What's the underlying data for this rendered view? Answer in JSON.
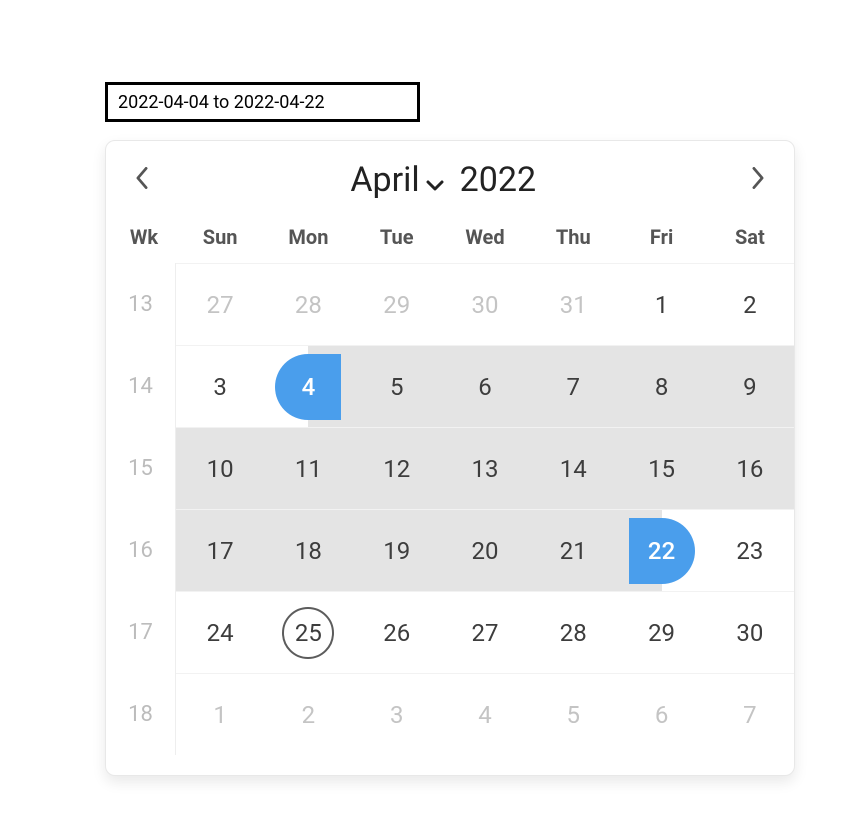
{
  "input": {
    "value": "2022-04-04 to 2022-04-22"
  },
  "header": {
    "month_label": "April",
    "year_value": "2022"
  },
  "weekday_header": {
    "wk": "Wk",
    "days": [
      "Sun",
      "Mon",
      "Tue",
      "Wed",
      "Thu",
      "Fri",
      "Sat"
    ]
  },
  "calendar": {
    "today_month_index": 3,
    "today_day_value": 25,
    "rows": [
      {
        "week": "13",
        "days": [
          {
            "n": "27",
            "kind": "prev"
          },
          {
            "n": "28",
            "kind": "prev"
          },
          {
            "n": "29",
            "kind": "prev"
          },
          {
            "n": "30",
            "kind": "prev"
          },
          {
            "n": "31",
            "kind": "prev"
          },
          {
            "n": "1",
            "kind": "cur"
          },
          {
            "n": "2",
            "kind": "cur"
          }
        ]
      },
      {
        "week": "14",
        "days": [
          {
            "n": "3",
            "kind": "cur"
          },
          {
            "n": "4",
            "kind": "cur",
            "range": "start"
          },
          {
            "n": "5",
            "kind": "cur",
            "range": "in"
          },
          {
            "n": "6",
            "kind": "cur",
            "range": "in"
          },
          {
            "n": "7",
            "kind": "cur",
            "range": "in"
          },
          {
            "n": "8",
            "kind": "cur",
            "range": "in"
          },
          {
            "n": "9",
            "kind": "cur",
            "range": "in"
          }
        ]
      },
      {
        "week": "15",
        "days": [
          {
            "n": "10",
            "kind": "cur",
            "range": "in"
          },
          {
            "n": "11",
            "kind": "cur",
            "range": "in"
          },
          {
            "n": "12",
            "kind": "cur",
            "range": "in"
          },
          {
            "n": "13",
            "kind": "cur",
            "range": "in"
          },
          {
            "n": "14",
            "kind": "cur",
            "range": "in"
          },
          {
            "n": "15",
            "kind": "cur",
            "range": "in"
          },
          {
            "n": "16",
            "kind": "cur",
            "range": "in"
          }
        ]
      },
      {
        "week": "16",
        "days": [
          {
            "n": "17",
            "kind": "cur",
            "range": "in"
          },
          {
            "n": "18",
            "kind": "cur",
            "range": "in"
          },
          {
            "n": "19",
            "kind": "cur",
            "range": "in"
          },
          {
            "n": "20",
            "kind": "cur",
            "range": "in"
          },
          {
            "n": "21",
            "kind": "cur",
            "range": "in"
          },
          {
            "n": "22",
            "kind": "cur",
            "range": "end"
          },
          {
            "n": "23",
            "kind": "cur"
          }
        ]
      },
      {
        "week": "17",
        "days": [
          {
            "n": "24",
            "kind": "cur"
          },
          {
            "n": "25",
            "kind": "cur",
            "today": true
          },
          {
            "n": "26",
            "kind": "cur"
          },
          {
            "n": "27",
            "kind": "cur"
          },
          {
            "n": "28",
            "kind": "cur"
          },
          {
            "n": "29",
            "kind": "cur"
          },
          {
            "n": "30",
            "kind": "cur"
          }
        ]
      },
      {
        "week": "18",
        "days": [
          {
            "n": "1",
            "kind": "next"
          },
          {
            "n": "2",
            "kind": "next"
          },
          {
            "n": "3",
            "kind": "next"
          },
          {
            "n": "4",
            "kind": "next"
          },
          {
            "n": "5",
            "kind": "next"
          },
          {
            "n": "6",
            "kind": "next"
          },
          {
            "n": "7",
            "kind": "next"
          }
        ]
      }
    ]
  }
}
